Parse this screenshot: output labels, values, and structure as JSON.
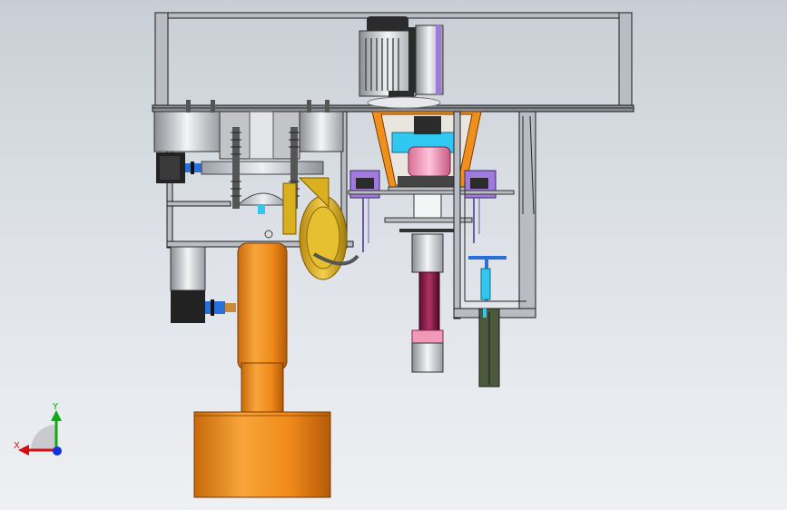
{
  "viewport": {
    "background": "gradient-gray"
  },
  "triad": {
    "x_label": "X",
    "y_label": "Y",
    "colors": {
      "x": "#d11111",
      "y": "#11aa11",
      "z": "#1133dd"
    }
  },
  "materials": {
    "frame": "#b9bcc2",
    "frame_edge": "#1a1a1a",
    "orange": "#f0901c",
    "orange_light": "#f8b95a",
    "gold": "#d8b020",
    "steel": "#d7d9dd",
    "copper": "#c98a3a",
    "pink": "#f09ab8",
    "magenta_rod": "#8a1f4a",
    "cyan": "#30c8f0",
    "purple": "#a07adc",
    "blue": "#2a6fd8",
    "dark": "#2b2b2b",
    "olive": "#4a5a3a"
  }
}
